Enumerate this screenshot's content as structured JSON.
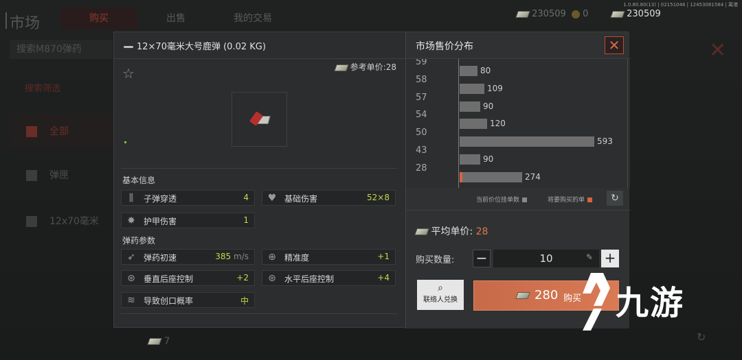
{
  "background": {
    "title": "市场",
    "tabs": [
      "购买",
      "出售",
      "我的交易"
    ],
    "search_text": "搜索M870弹药",
    "filter_text": "搜索筛选",
    "sidebar": [
      "全部",
      "弹匣",
      "12x70毫米"
    ],
    "currency_1": "230509",
    "currency_2": "0",
    "currency_3": "230509",
    "version": "1.0.80.80(13) | 02151046 | 12453081584 | 离港",
    "bottom_value": "7"
  },
  "item": {
    "title": "12×70毫米大号鹿弹 (0.02 KG)",
    "ref_price_label": "参考单价:",
    "ref_price": "28"
  },
  "basic_info": {
    "heading": "基本信息",
    "stats": [
      {
        "label": "子弹穿透",
        "value": "4",
        "icon": "bullets-icon"
      },
      {
        "label": "基础伤害",
        "value": "52×8",
        "icon": "broken-heart-icon"
      },
      {
        "label": "护甲伤害",
        "value": "1",
        "icon": "armor-break-icon"
      }
    ]
  },
  "ammo_params": {
    "heading": "弹药参数",
    "stats": [
      {
        "label": "弹药初速",
        "value": "385",
        "unit": "m/s",
        "icon": "rocket-icon"
      },
      {
        "label": "精准度",
        "value": "+1",
        "icon": "crosshair-icon"
      },
      {
        "label": "垂直后座控制",
        "value": "+2",
        "icon": "vertical-recoil-icon"
      },
      {
        "label": "水平后座控制",
        "value": "+4",
        "icon": "horizontal-recoil-icon"
      },
      {
        "label": "导致创口概率",
        "value": "中",
        "icon": "wound-icon"
      }
    ]
  },
  "market": {
    "title": "市场售价分布",
    "close_label": "✕",
    "legend_current": "当前价位挂单数",
    "legend_mine": "将要购买的单",
    "avg_label": "平均单价:",
    "avg_value": "28",
    "qty_label": "购买数量:",
    "qty_value": "10",
    "contact_label": "联络人兑换",
    "buy_price": "280",
    "buy_label": "购买",
    "colors": {
      "accent": "#d8633f",
      "bar": "#6e6e6e"
    }
  },
  "chart_data": {
    "type": "bar",
    "orientation": "horizontal",
    "categories": [
      "59",
      "58",
      "57",
      "54",
      "50",
      "43",
      "28"
    ],
    "values": [
      80,
      109,
      90,
      120,
      593,
      90,
      274
    ],
    "highlighted_category": "28"
  },
  "watermark": {
    "text": "九游"
  }
}
